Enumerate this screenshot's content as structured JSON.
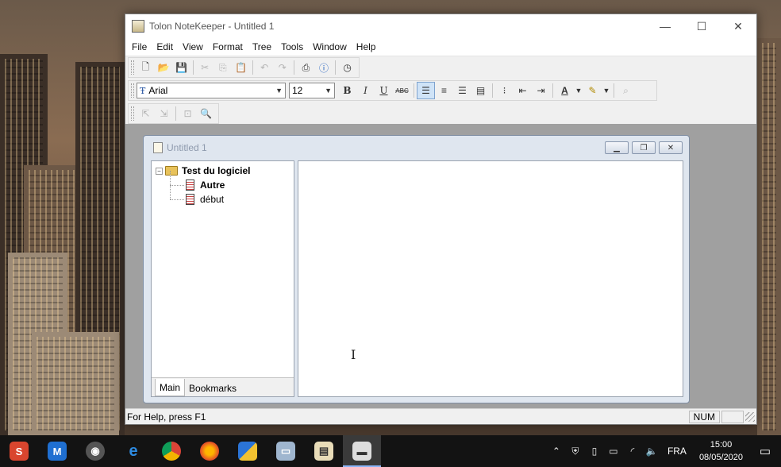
{
  "window": {
    "title": "Tolon NoteKeeper - Untitled 1"
  },
  "menu": [
    "File",
    "Edit",
    "View",
    "Format",
    "Tree",
    "Tools",
    "Window",
    "Help"
  ],
  "format_toolbar": {
    "font": "Arial",
    "size": "12",
    "bold": "B",
    "italic": "I",
    "underline": "U",
    "strike": "ABC"
  },
  "child": {
    "title": "Untitled 1"
  },
  "tree": {
    "root": {
      "label": "Test du logiciel",
      "expander": "−"
    },
    "children": [
      {
        "label": "Autre"
      },
      {
        "label": "début"
      }
    ]
  },
  "pane_tabs": [
    "Main",
    "Bookmarks"
  ],
  "status": {
    "help": "For Help, press F1",
    "num": "NUM"
  },
  "taskbar": {
    "lang": "FRA",
    "time": "15:00",
    "date": "08/05/2020"
  },
  "colors": {
    "taskbar_bg": "#131313",
    "mdi_bg": "#a0a0a0",
    "child_bg": "#dfe6ef",
    "active_align": "#cfe3f7"
  }
}
